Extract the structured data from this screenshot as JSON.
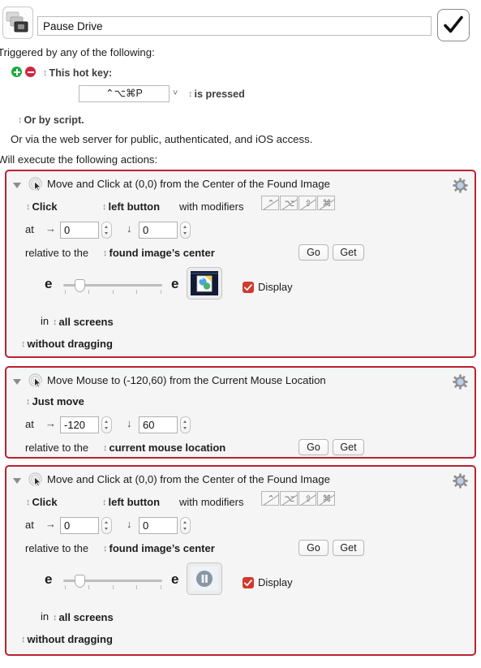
{
  "header": {
    "macro_icon_name": "macro-group-stack-icon",
    "title_value": "Pause Drive",
    "apply_icon_name": "checkmark-icon"
  },
  "triggers": {
    "heading": "Triggered by any of the following:",
    "add_label": "+",
    "remove_label": "−",
    "trigger_type": "This hot key:",
    "hotkey_value": "⌃⌥⌘P",
    "hotkey_condition": "is pressed",
    "or_by_script": "Or by script.",
    "web_server_note": "Or via the web server for public, authenticated, and iOS access."
  },
  "actions_heading": "Will execute the following actions:",
  "actions": [
    {
      "title": "Move and Click at (0,0) from the Center of the Found Image",
      "click_mode": "Click",
      "button": "left button",
      "modifiers_label": "with modifiers",
      "modifiers": [
        {
          "name": "control-modifier",
          "glyph": "⌃",
          "enabled": false
        },
        {
          "name": "option-modifier",
          "glyph": "⌥",
          "enabled": false
        },
        {
          "name": "shift-modifier",
          "glyph": "⇧",
          "enabled": false
        },
        {
          "name": "command-modifier",
          "glyph": "⌘",
          "enabled": false
        }
      ],
      "at_label": "at",
      "x_arrow": "→",
      "x_value": "0",
      "y_arrow": "↓",
      "y_value": "0",
      "relative_label": "relative to the",
      "relative_value": "found image’s center",
      "go_label": "Go",
      "get_label": "Get",
      "fuzz_left": "e",
      "fuzz_right": "e",
      "fuzz_position_pct": 18,
      "image_icon_name": "photo-document-thumbnail",
      "display_label": "Display",
      "display_checked": true,
      "in_label": "in",
      "screens_value": "all screens",
      "drag_value": "without dragging",
      "gear_icon_name": "gear-icon",
      "cursor_icon_name": "mouse-click-ripple-icon"
    },
    {
      "title": "Move Mouse to (-120,60) from the Current Mouse Location",
      "click_mode": "Just move",
      "at_label": "at",
      "x_arrow": "→",
      "x_value": "-120",
      "y_arrow": "↓",
      "y_value": "60",
      "relative_label": "relative to the",
      "relative_value": "current mouse location",
      "go_label": "Go",
      "get_label": "Get",
      "gear_icon_name": "gear-icon",
      "cursor_icon_name": "mouse-click-ripple-icon"
    },
    {
      "title": "Move and Click at (0,0) from the Center of the Found Image",
      "click_mode": "Click",
      "button": "left button",
      "modifiers_label": "with modifiers",
      "modifiers": [
        {
          "name": "control-modifier",
          "glyph": "⌃",
          "enabled": false
        },
        {
          "name": "option-modifier",
          "glyph": "⌥",
          "enabled": false
        },
        {
          "name": "shift-modifier",
          "glyph": "⇧",
          "enabled": false
        },
        {
          "name": "command-modifier",
          "glyph": "⌘",
          "enabled": false
        }
      ],
      "at_label": "at",
      "x_arrow": "→",
      "x_value": "0",
      "y_arrow": "↓",
      "y_value": "0",
      "relative_label": "relative to the",
      "relative_value": "found image’s center",
      "go_label": "Go",
      "get_label": "Get",
      "fuzz_left": "e",
      "fuzz_right": "e",
      "fuzz_position_pct": 18,
      "image_icon_name": "pause-button-thumbnail",
      "display_label": "Display",
      "display_checked": true,
      "in_label": "in",
      "screens_value": "all screens",
      "drag_value": "without dragging",
      "gear_icon_name": "gear-icon",
      "cursor_icon_name": "mouse-click-ripple-icon"
    }
  ],
  "colors": {
    "action_border": "#bb2233",
    "action_bg": "#f5f5f5",
    "checkbox_red": "#cf3b2f",
    "add_green": "#1faa3f",
    "remove_red": "#cf2640"
  }
}
